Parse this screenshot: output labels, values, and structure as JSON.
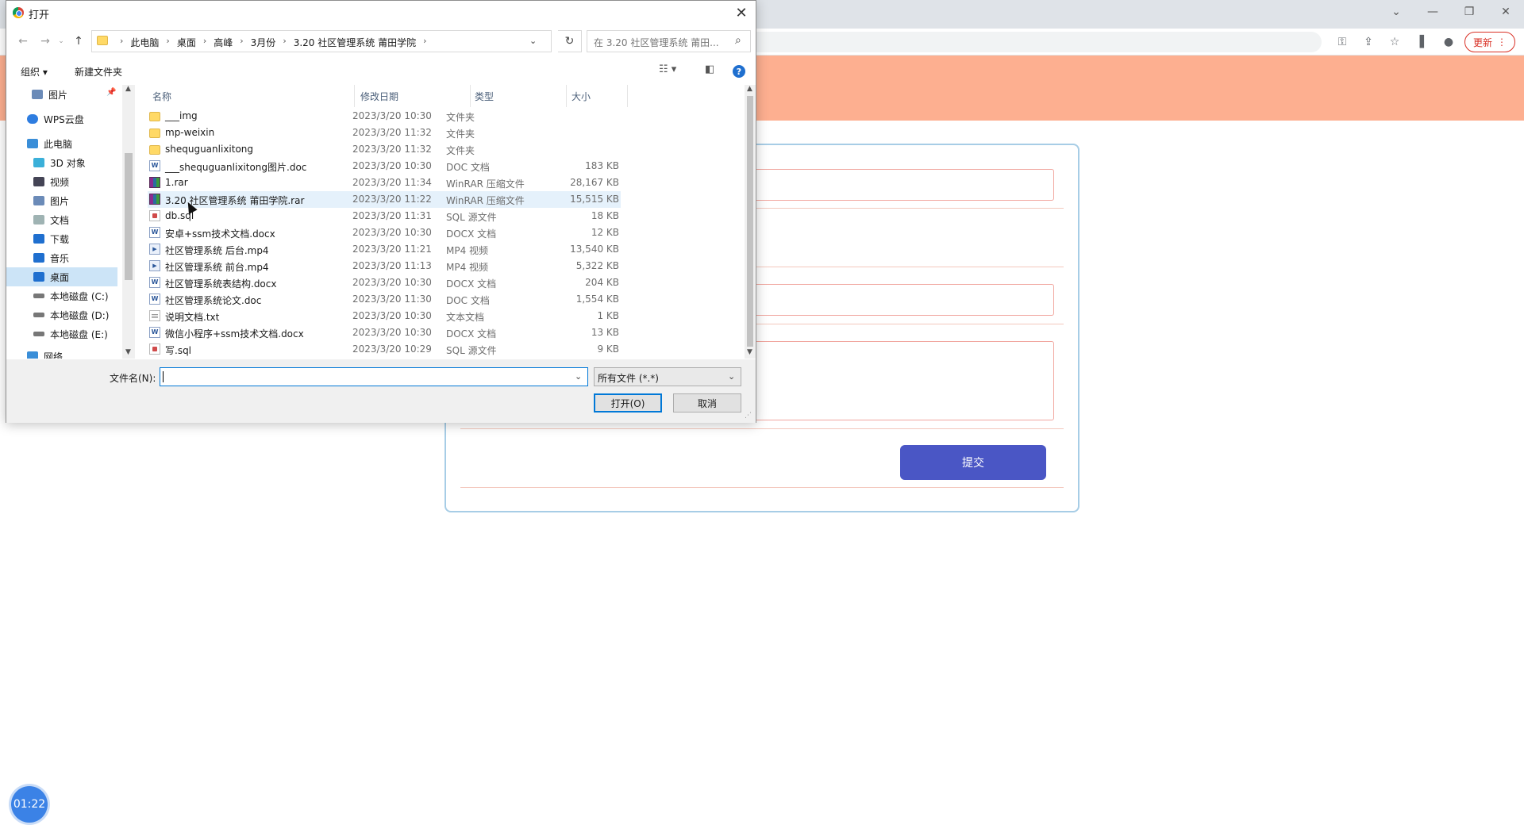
{
  "browser": {
    "update_label": "更新",
    "window_controls": [
      "chevron-down",
      "minimize",
      "restore",
      "close"
    ],
    "toolbar_icons": [
      "key-icon",
      "share-icon",
      "star-icon",
      "sidebar-icon",
      "profile-icon"
    ]
  },
  "page": {
    "band_color": "#fdaf90",
    "submit_label": "提交",
    "accent": "#4a56c5",
    "timer": "01:22"
  },
  "dialog": {
    "title": "打开",
    "breadcrumbs": [
      "此电脑",
      "桌面",
      "高峰",
      "3月份",
      "3.20 社区管理系统  莆田学院"
    ],
    "search_placeholder": "在 3.20 社区管理系统  莆田...",
    "organize_label": "组织 ▾",
    "new_folder_label": "新建文件夹",
    "nav": [
      {
        "label": "图片",
        "icon": "pictures-icon",
        "color": "#6b8bb8",
        "pinned": true
      },
      {
        "label": "WPS云盘",
        "icon": "cloud-icon",
        "color": "#2e7de0"
      },
      {
        "label": "此电脑",
        "icon": "computer-icon",
        "color": "#3a8ed8"
      },
      {
        "label": "3D 对象",
        "icon": "cube-icon",
        "color": "#3bb0d9"
      },
      {
        "label": "视频",
        "icon": "video-icon",
        "color": "#556"
      },
      {
        "label": "图片",
        "icon": "pictures-icon",
        "color": "#6b8bb8"
      },
      {
        "label": "文档",
        "icon": "document-icon",
        "color": "#8aa"
      },
      {
        "label": "下载",
        "icon": "download-icon",
        "color": "#1f6fcf"
      },
      {
        "label": "音乐",
        "icon": "music-icon",
        "color": "#1f6fcf"
      },
      {
        "label": "桌面",
        "icon": "desktop-icon",
        "color": "#1f6fcf",
        "selected": true
      },
      {
        "label": "本地磁盘 (C:)",
        "icon": "drive-icon",
        "color": "#666"
      },
      {
        "label": "本地磁盘 (D:)",
        "icon": "drive-icon",
        "color": "#666"
      },
      {
        "label": "本地磁盘 (E:)",
        "icon": "drive-icon",
        "color": "#666"
      },
      {
        "label": "网络",
        "icon": "network-icon",
        "color": "#3a8ed8"
      }
    ],
    "columns": [
      "名称",
      "修改日期",
      "类型",
      "大小"
    ],
    "files": [
      {
        "name": "___img",
        "date": "2023/3/20 10:30",
        "type": "文件夹",
        "size": "",
        "icon": "folder"
      },
      {
        "name": "mp-weixin",
        "date": "2023/3/20 11:32",
        "type": "文件夹",
        "size": "",
        "icon": "folder"
      },
      {
        "name": "shequguanlixitong",
        "date": "2023/3/20 11:32",
        "type": "文件夹",
        "size": "",
        "icon": "folder"
      },
      {
        "name": "___shequguanlixitong图片.doc",
        "date": "2023/3/20 10:30",
        "type": "DOC 文档",
        "size": "183 KB",
        "icon": "word"
      },
      {
        "name": "1.rar",
        "date": "2023/3/20 11:34",
        "type": "WinRAR 压缩文件",
        "size": "28,167 KB",
        "icon": "rar"
      },
      {
        "name": "3.20 社区管理系统  莆田学院.rar",
        "date": "2023/3/20 11:22",
        "type": "WinRAR 压缩文件",
        "size": "15,515 KB",
        "icon": "rar",
        "hover": true
      },
      {
        "name": "db.sql",
        "date": "2023/3/20 11:31",
        "type": "SQL 源文件",
        "size": "18 KB",
        "icon": "sql"
      },
      {
        "name": "安卓+ssm技术文档.docx",
        "date": "2023/3/20 10:30",
        "type": "DOCX 文档",
        "size": "12 KB",
        "icon": "word"
      },
      {
        "name": "社区管理系统 后台.mp4",
        "date": "2023/3/20 11:21",
        "type": "MP4 视频",
        "size": "13,540 KB",
        "icon": "video"
      },
      {
        "name": "社区管理系统 前台.mp4",
        "date": "2023/3/20 11:13",
        "type": "MP4 视频",
        "size": "5,322 KB",
        "icon": "video"
      },
      {
        "name": "社区管理系统表结构.docx",
        "date": "2023/3/20 10:30",
        "type": "DOCX 文档",
        "size": "204 KB",
        "icon": "word"
      },
      {
        "name": "社区管理系统论文.doc",
        "date": "2023/3/20 11:30",
        "type": "DOC 文档",
        "size": "1,554 KB",
        "icon": "word"
      },
      {
        "name": "说明文档.txt",
        "date": "2023/3/20 10:30",
        "type": "文本文档",
        "size": "1 KB",
        "icon": "txt"
      },
      {
        "name": "微信小程序+ssm技术文档.docx",
        "date": "2023/3/20 10:30",
        "type": "DOCX 文档",
        "size": "13 KB",
        "icon": "word"
      },
      {
        "name": "写.sql",
        "date": "2023/3/20 10:29",
        "type": "SQL 源文件",
        "size": "9 KB",
        "icon": "sql"
      }
    ],
    "filename_label": "文件名(N):",
    "filename_value": "",
    "filetype_value": "所有文件 (*.*)",
    "open_label": "打开(O)",
    "cancel_label": "取消"
  }
}
